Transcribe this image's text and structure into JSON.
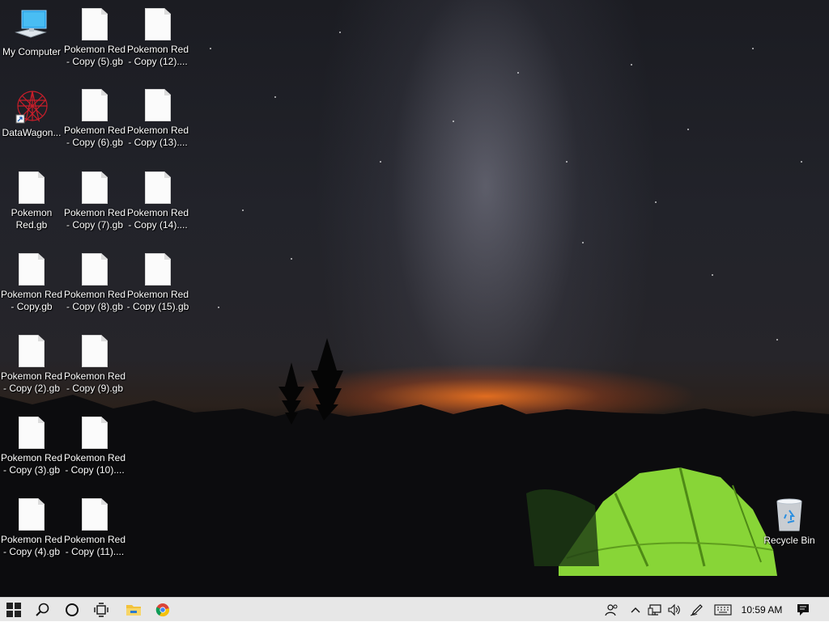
{
  "desktop": {
    "icons": [
      {
        "id": "my-computer",
        "label": "My Computer",
        "type": "computer"
      },
      {
        "id": "file-5",
        "label": "Pokemon Red - Copy (5).gb",
        "type": "file"
      },
      {
        "id": "file-12",
        "label": "Pokemon Red - Copy (12)....",
        "type": "file"
      },
      {
        "id": "datawagon",
        "label": "DataWagon...",
        "type": "shortcut"
      },
      {
        "id": "file-6",
        "label": "Pokemon Red - Copy (6).gb",
        "type": "file"
      },
      {
        "id": "file-13",
        "label": "Pokemon Red - Copy (13)....",
        "type": "file"
      },
      {
        "id": "file-orig",
        "label": "Pokemon Red.gb",
        "type": "file"
      },
      {
        "id": "file-7",
        "label": "Pokemon Red - Copy (7).gb",
        "type": "file"
      },
      {
        "id": "file-14",
        "label": "Pokemon Red - Copy (14)....",
        "type": "file"
      },
      {
        "id": "file-1",
        "label": "Pokemon Red - Copy.gb",
        "type": "file"
      },
      {
        "id": "file-8",
        "label": "Pokemon Red - Copy (8).gb",
        "type": "file"
      },
      {
        "id": "file-15",
        "label": "Pokemon Red - Copy (15).gb",
        "type": "file"
      },
      {
        "id": "file-2",
        "label": "Pokemon Red - Copy (2).gb",
        "type": "file"
      },
      {
        "id": "file-9",
        "label": "Pokemon Red - Copy (9).gb",
        "type": "file"
      },
      {
        "id": "file-3",
        "label": "Pokemon Red - Copy (3).gb",
        "type": "file"
      },
      {
        "id": "file-10",
        "label": "Pokemon Red - Copy (10)....",
        "type": "file"
      },
      {
        "id": "file-4",
        "label": "Pokemon Red - Copy (4).gb",
        "type": "file"
      },
      {
        "id": "file-11",
        "label": "Pokemon Red - Copy (11)....",
        "type": "file"
      },
      {
        "id": "recycle-bin",
        "label": "Recycle Bin",
        "type": "recycle"
      }
    ]
  },
  "taskbar": {
    "start_icon": "windows-logo-icon",
    "search_icon": "search-icon",
    "cortana_icon": "cortana-circle-icon",
    "task_view_icon": "task-view-icon",
    "pinned": [
      "file-explorer-icon",
      "chrome-icon"
    ],
    "tray_icons": [
      "people-icon",
      "chevron-up-icon",
      "network-icon",
      "volume-icon",
      "pen-icon",
      "keyboard-icon"
    ],
    "clock": "10:59 AM",
    "notification_icon": "action-center-icon"
  },
  "colors": {
    "taskbar_bg": "#e7e7e7",
    "tent_green": "#8fe03a",
    "horizon_orange": "#ff7a22"
  }
}
